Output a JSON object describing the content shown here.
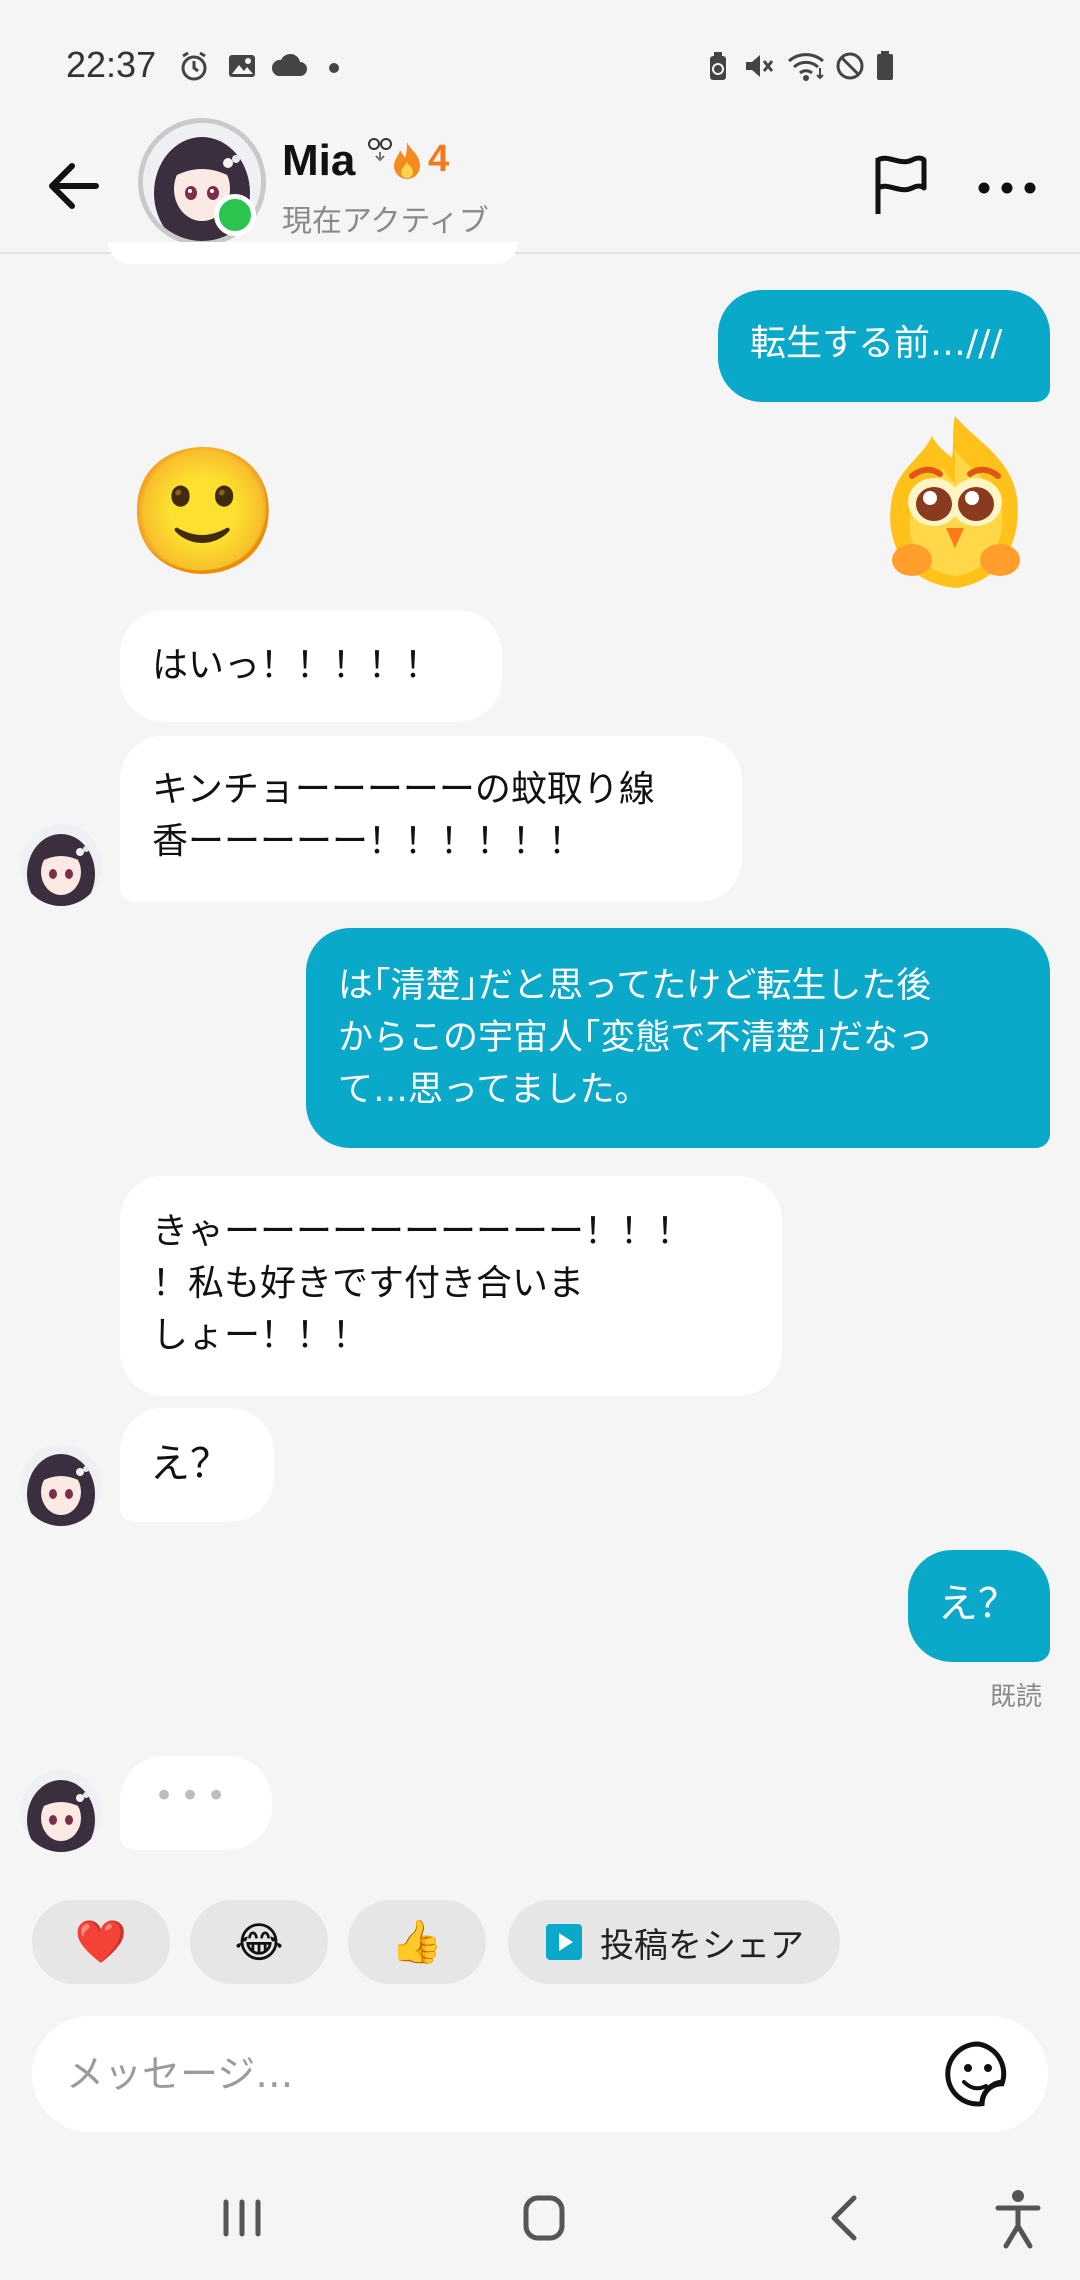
{
  "status_bar": {
    "time": "22:37",
    "icons": [
      "alarm-icon",
      "image-icon",
      "cloud-icon",
      "dot-icon",
      "battery-saver-icon",
      "mute-icon",
      "wifi-icon",
      "dnd-icon",
      "battery-icon"
    ]
  },
  "header": {
    "name": "Mia",
    "streak_count": "4",
    "status": "現在アクティブ"
  },
  "messages": [
    {
      "side": "out",
      "text": "転生する前…///"
    },
    {
      "side": "out",
      "sticker": "fire-character-sticker"
    },
    {
      "side": "in",
      "emoji": "🙂"
    },
    {
      "side": "in",
      "text": "はいっ！！！！！"
    },
    {
      "side": "in",
      "text": "キンチョーーーーーの蚊取り線\n香ーーーーー！！！！！！"
    },
    {
      "side": "out",
      "text": "は｢清楚｣だと思ってたけど転生した後\nからこの宇宙人｢変態で不清楚｣だなっ\nて…思ってました。"
    },
    {
      "side": "in",
      "text": "きゃーーーーーーーーーー！！！\n！私も好きです付き合いま\nしょー！！！"
    },
    {
      "side": "in",
      "text": "え？"
    },
    {
      "side": "out",
      "text": "え？"
    }
  ],
  "read_receipt": "既読",
  "typing_indicator": "•••",
  "quick_replies": {
    "heart": "❤️",
    "laugh": "😂",
    "thumbs_up": "👍",
    "share_label": "投稿をシェア"
  },
  "composer": {
    "placeholder": "メッセージ…"
  },
  "colors": {
    "outgoing_bubble": "#0aa8c9",
    "incoming_bubble": "#ffffff",
    "online": "#2ac44e",
    "streak": "#f07a1c"
  }
}
